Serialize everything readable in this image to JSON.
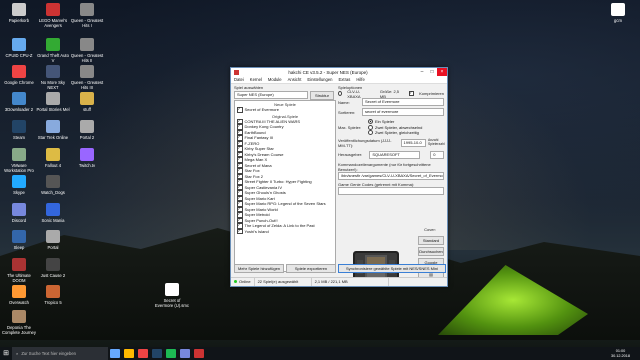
{
  "desktop": {
    "icons": [
      {
        "label": "Papierkorb",
        "color": "#ccc"
      },
      {
        "label": "LEGO Marvel's Avengers",
        "color": "#c33"
      },
      {
        "label": "Queen - Greatest Hits I",
        "color": "#888"
      },
      {
        "label": "CPUID CPU-Z",
        "color": "#6ae"
      },
      {
        "label": "Grand Theft Auto V",
        "color": "#3a3"
      },
      {
        "label": "Queen - Greatest Hits II",
        "color": "#888"
      },
      {
        "label": "Google Chrome",
        "color": "#e44"
      },
      {
        "label": "No More Sky NEXT",
        "color": "#457"
      },
      {
        "label": "Queen - Greatest Hits III",
        "color": "#888"
      },
      {
        "label": "3Downloader 2",
        "color": "#48c"
      },
      {
        "label": "Portal Stories Mel",
        "color": "#aaa"
      },
      {
        "label": "stuff",
        "color": "#d9b24a"
      },
      {
        "label": "Steam",
        "color": "#246"
      },
      {
        "label": "Star Trek Online",
        "color": "#8ad"
      },
      {
        "label": "Portal 2",
        "color": "#aaa"
      },
      {
        "label": "VMware Workstation Pro",
        "color": "#8a8"
      },
      {
        "label": "Fallout 4",
        "color": "#db4"
      },
      {
        "label": "Twitch.tv",
        "color": "#96f"
      },
      {
        "label": "Skype",
        "color": "#2af"
      },
      {
        "label": "Watch_Dogs",
        "color": "#555"
      },
      {
        "label": "Discord",
        "color": "#78d"
      },
      {
        "label": "Sonic Mania",
        "color": "#36d"
      },
      {
        "label": "Sleep",
        "color": "#36a"
      },
      {
        "label": "Portal",
        "color": "#aaa"
      },
      {
        "label": "The Ultimate DOOM",
        "color": "#a33"
      },
      {
        "label": "Just Cause 2",
        "color": "#444"
      },
      {
        "label": "Overwatch",
        "color": "#f93"
      },
      {
        "label": "Tropico 5",
        "color": "#c63"
      },
      {
        "label": "Deponia The Complete Journey",
        "color": "#a86"
      },
      {
        "label": "Secret of Evermore (U).smc",
        "color": "#fff"
      },
      {
        "label": "gcm",
        "color": "#fff"
      }
    ]
  },
  "window": {
    "title": "hakchi CE v3.5.2 - Super NES (Europe)",
    "menu": [
      "Datei",
      "Kernel",
      "Module",
      "Ansicht",
      "Einstellungen",
      "Extras",
      "Hilfe"
    ],
    "left": {
      "label": "Spiel auswählen",
      "console": "Super NES (Europe)",
      "struct_btn": "Struktur",
      "new_group": "Neue Spiele",
      "new_games": [
        {
          "name": "Secret of Evermore",
          "on": true
        }
      ],
      "orig_group": "Original-Spiele",
      "games": [
        {
          "name": "CONTRA III THE ALIEN WARS",
          "on": true
        },
        {
          "name": "Donkey Kong Country",
          "on": true
        },
        {
          "name": "EarthBound",
          "on": true
        },
        {
          "name": "Final Fantasy III",
          "on": true
        },
        {
          "name": "F-ZERO",
          "on": true
        },
        {
          "name": "Kirby Super Star",
          "on": true
        },
        {
          "name": "Kirby's Dream Course",
          "on": true
        },
        {
          "name": "Mega Man X",
          "on": true
        },
        {
          "name": "Secret of Mana",
          "on": true
        },
        {
          "name": "Star Fox",
          "on": true
        },
        {
          "name": "Star Fox 2",
          "on": true
        },
        {
          "name": "Street Fighter II Turbo: Hyper Fighting",
          "on": true
        },
        {
          "name": "Super Castlevania IV",
          "on": true
        },
        {
          "name": "Super Ghouls'n Ghosts",
          "on": true
        },
        {
          "name": "Super Mario Kart",
          "on": true
        },
        {
          "name": "Super Mario RPG: Legend of the Seven Stars",
          "on": true
        },
        {
          "name": "Super Mario World",
          "on": true
        },
        {
          "name": "Super Metroid",
          "on": true
        },
        {
          "name": "Super Punch-Out!!",
          "on": true
        },
        {
          "name": "The Legend of Zelda: A Link to the Past",
          "on": true
        },
        {
          "name": "Yoshi's Island",
          "on": true
        }
      ],
      "add_btn": "Mehr Spiele hinzufügen",
      "export_btn": "Spiele exportieren"
    },
    "right": {
      "section": "Spieloptionen",
      "source": "CLV-U-XBAXA",
      "size": "Größe: 2,5 MB",
      "compress": "Komprimieren",
      "name_label": "Name:",
      "name_value": "Secret of Evermore",
      "sort_label": "Sortieren:",
      "sort_value": "secret of evermore",
      "players_label": "Max. Spieler:",
      "players": [
        {
          "label": "Ein Spieler",
          "on": true
        },
        {
          "label": "Zwei Spieler, abwechselnd",
          "on": false
        },
        {
          "label": "Zwei Spieler, gleichzeitig",
          "on": false
        }
      ],
      "date_label": "Veröffentlichungsdatum (JJJJ-MM-TT):",
      "date_value": "1995-10-0",
      "players_count_label": "Anzahl Spielerzahl",
      "publisher_label": "Herausgeber:",
      "publisher_value": "SQUARESOFT",
      "score_value": "0",
      "cmd_label": "Kommandozeilenargumente (nur für fortgeschrittene Benutzer!):",
      "cmd_value": "/bin/snesfir /var/games/CLV-U-XBAXA/Secret_of_Evermore.sfrom",
      "genie_label": "Game Genie Codes (getrennt mit Komma):",
      "cover_label": "Cover:",
      "cover_btns": [
        "Standard",
        "Durchsuchen",
        "Google"
      ],
      "sync_btn": "Synchronisiere gewählte Spiele mit NES/SNES Mini"
    },
    "status": [
      "Online",
      "22 Spiel(e) ausgewählt",
      "2,1 MB / 221,1 MB"
    ]
  },
  "taskbar": {
    "search_placeholder": "Zur Suche Text hier eingeben",
    "time": "01:00",
    "date": "30.12.2018"
  }
}
